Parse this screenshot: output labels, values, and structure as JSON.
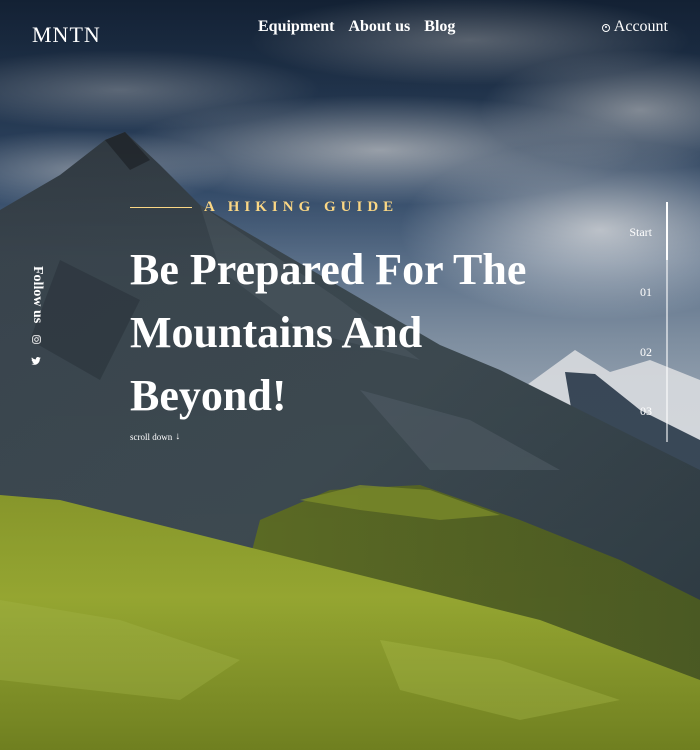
{
  "header": {
    "brand": "MNTN",
    "nav": [
      {
        "label": "Equipment"
      },
      {
        "label": "About us"
      },
      {
        "label": "Blog"
      }
    ],
    "account_label": "Account",
    "account_icon": "account-icon"
  },
  "sidebar": {
    "follow_label": "Follow us",
    "social": [
      {
        "icon": "instagram-icon"
      },
      {
        "icon": "twitter-icon"
      }
    ]
  },
  "hero": {
    "eyebrow": "A HIKING GUIDE",
    "headline": "Be Prepared For The Mountains And Beyond!",
    "scroll_label": "scroll down",
    "scroll_icon": "arrow-down-icon"
  },
  "pager": {
    "items": [
      {
        "label": "Start"
      },
      {
        "label": "01"
      },
      {
        "label": "02"
      },
      {
        "label": "03"
      }
    ],
    "active_index": 0
  },
  "colors": {
    "accent": "#fbd784",
    "text": "#ffffff",
    "sky": "#2f4a66",
    "grass": "#8ea12a"
  }
}
